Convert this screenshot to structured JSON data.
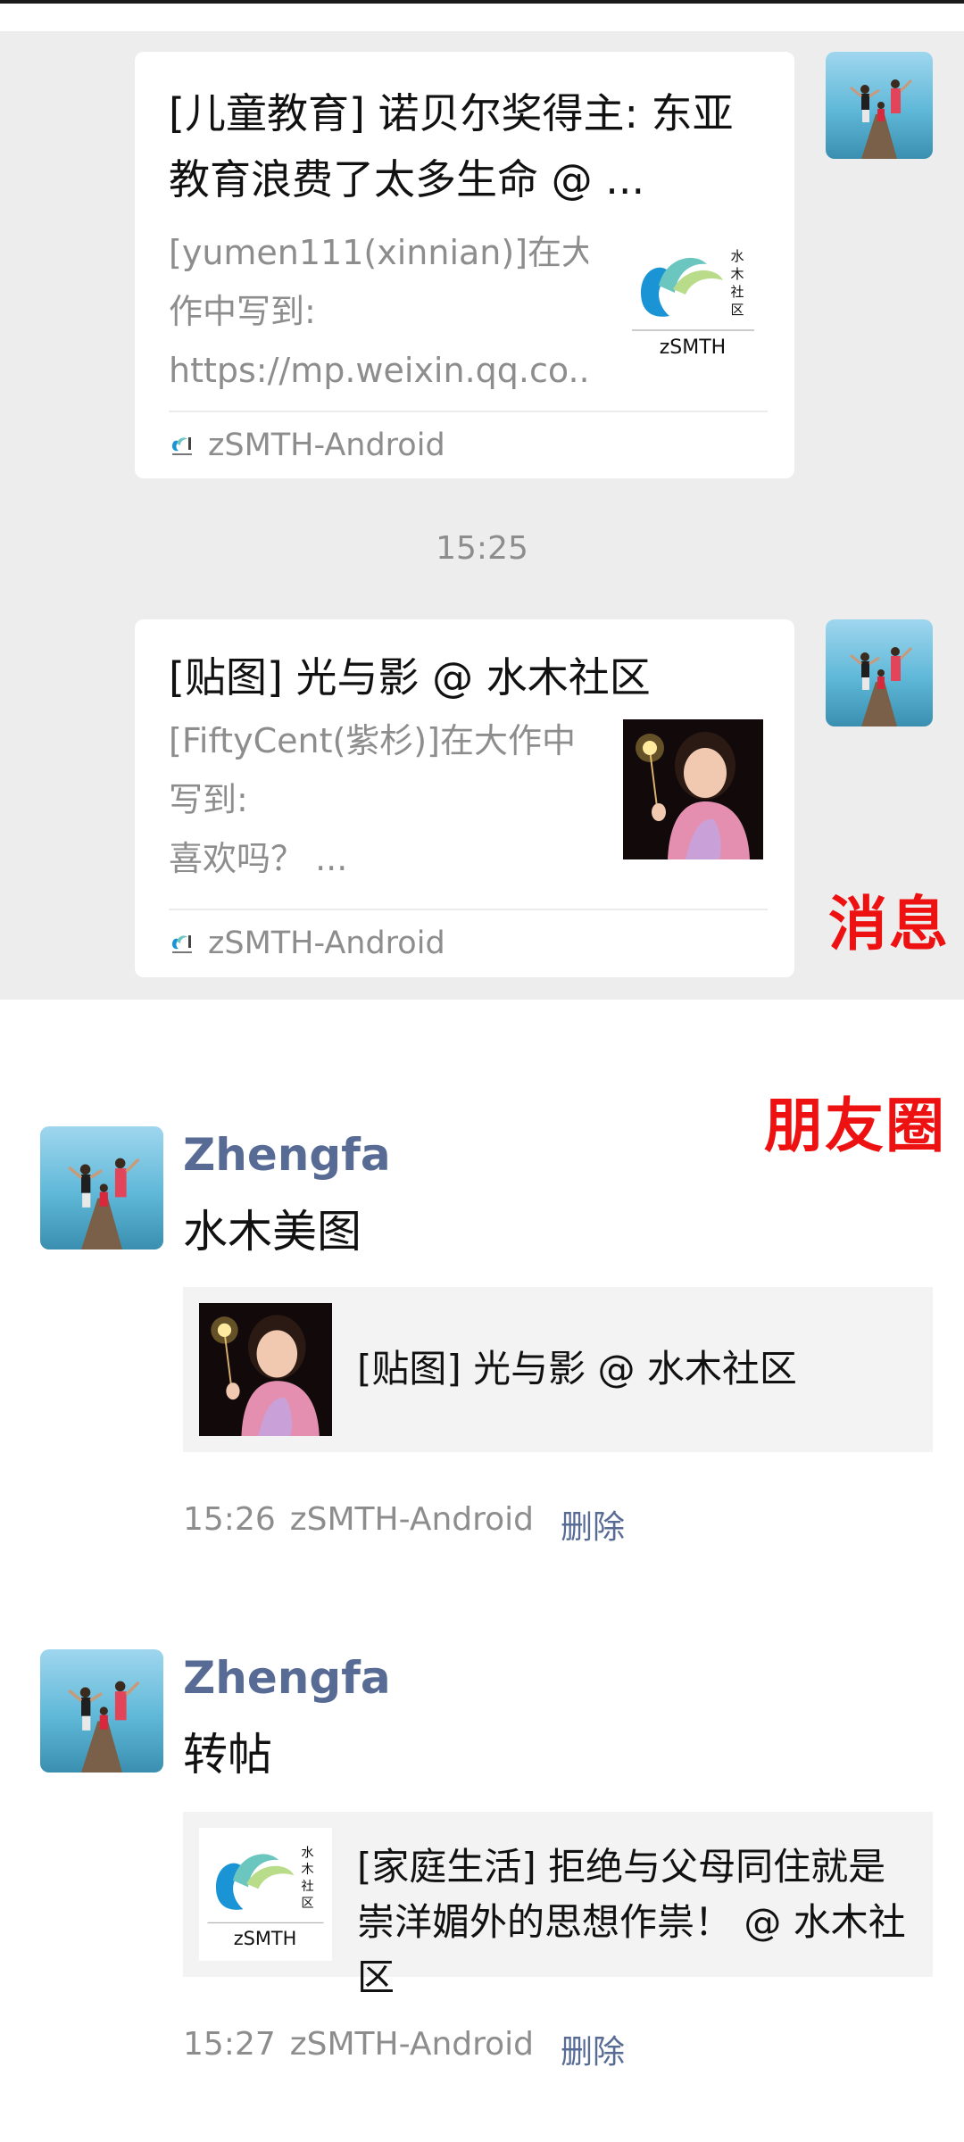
{
  "messages": {
    "label": "消息",
    "items": [
      {
        "title": "[儿童教育] 诺贝尔奖得主: 东亚教育浪费了太多生命 @ ...",
        "desc": [
          "[yumen111(xinnian)]在大",
          "作中写到:",
          "https://mp.weixin.qq.co..."
        ],
        "thumb_caption": "zSMTH",
        "thumb_brand": "水木社区",
        "source": "zSMTH-Android"
      },
      {
        "title": "[贴图] 光与影 @ 水木社区",
        "desc": [
          "[FiftyCent(紫杉)]在大作中",
          "写到:",
          "喜欢吗？ ..."
        ],
        "source": "zSMTH-Android"
      }
    ],
    "time": "15:25"
  },
  "moments": {
    "label": "朋友圈",
    "posts": [
      {
        "name": "Zhengfa",
        "text": "水木美图",
        "share_title": "[贴图] 光与影 @ 水木社区",
        "time": "15:26",
        "source": "zSMTH-Android",
        "delete": "删除"
      },
      {
        "name": "Zhengfa",
        "text": "转帖",
        "share_title": "[家庭生活] 拒绝与父母同住就是崇洋媚外的思想作祟！ @ 水木社区",
        "thumb_caption": "zSMTH",
        "thumb_brand": "水木社区",
        "time": "15:27",
        "source": "zSMTH-Android",
        "delete": "删除"
      }
    ]
  },
  "colors": {
    "chat_bg": "#ededed",
    "link_name": "#576b95",
    "label_red": "#ee1111"
  },
  "icons": [
    "avatar-photo",
    "zsmth-logo",
    "girl-sparkler-photo"
  ]
}
